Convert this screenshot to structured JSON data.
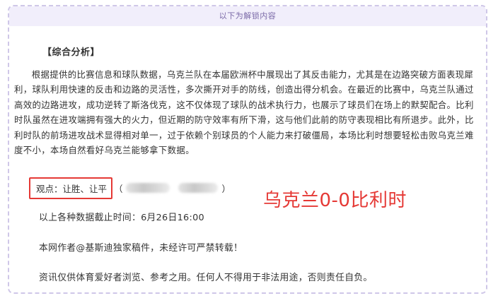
{
  "header": {
    "notice": "以下为解锁内容"
  },
  "article": {
    "section_title": "【综合分析】",
    "analysis": "根据提供的比赛信息和球队数据，乌克兰队在本届欧洲杯中展现出了其反击能力，尤其是在边路突破方面表现犀利，球队利用快速的反击和边路的灵活性，多次撕开对手的防线，创造出得分机会。在最近的比赛中，乌克兰队通过高效的边路进攻，成功逆转了斯洛伐克，这不仅体现了球队的战术执行力，也展示了球员们在场上的默契配合。比利时队虽然在进攻端拥有强大的火力，但近期的防守效率有所下滑，这与他们此前的防守表现相比有所退步。此外，比利时队的前场进攻战术显得相对单一，过于依赖个别球员的个人能力来打破僵局，本场比利时想要轻松击败乌克兰难度不小，本场自然看好乌克兰能够拿下数据。",
    "opinion": "观点：让胜、让平",
    "opinion_paren_open": "（",
    "opinion_paren_close": "）",
    "prediction": "乌克兰0-0比利时",
    "data_cutoff": "以上各种数据截止时间：6月26日16:00",
    "copyright": "本网作者@基斯迪独家稿件，未经许可严禁转载！",
    "disclaimer": "资讯仅供体育爱好者浏览、参考之用。任何人不得用于非法用途，否则责任自负。"
  },
  "colors": {
    "accent_red": "#e53935",
    "header_bg": "#f1eefb",
    "header_text": "#7b6aa8",
    "border": "#cfc7e8"
  }
}
